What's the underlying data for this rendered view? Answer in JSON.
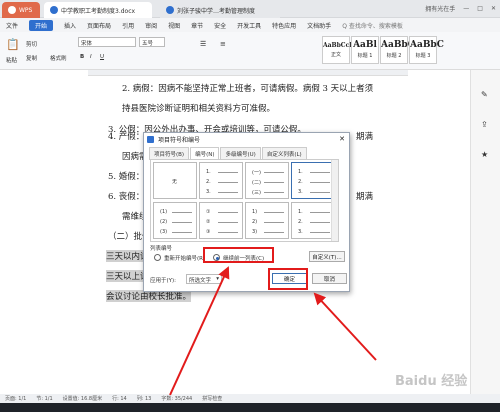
{
  "titlebar": {
    "app": "WPS",
    "doc1": "中学教职工考勤制度3.docx",
    "doc2": "刘张子骏中学…考勤管理制度",
    "user": "拥有光在手"
  },
  "menu": [
    "文件",
    "开始",
    "插入",
    "页面布局",
    "引用",
    "审阅",
    "视图",
    "章节",
    "安全",
    "开发工具",
    "特色应用",
    "文档助手"
  ],
  "menu_tail": "Q 查找命令、搜索模板",
  "ribbon": {
    "paste": "粘贴",
    "cut": "剪切",
    "copy": "复制",
    "format_painter": "格式刷",
    "font": "宋体",
    "size": "五号",
    "styles": [
      {
        "preview": "AaBbCcDd",
        "label": "正文"
      },
      {
        "preview": "AaBl",
        "label": "标题 1"
      },
      {
        "preview": "AaBbC",
        "label": "标题 2"
      },
      {
        "preview": "AaBbC",
        "label": "标题 3"
      }
    ]
  },
  "doc": {
    "p2a": "2. 病假：因病不能坚持正常上班者，可请病假。病假 3 天以上者须",
    "p2b": "持县医院诊断证明和相关资料方可准假。",
    "p3": "3. 公假：因公外出办事、开会或培训等，可请公假。",
    "p4a": "4. 产假：",
    "p4tail": "期满",
    "p4b": "因病需",
    "p5": "5. 婚假：",
    "p6a": "6. 丧假：",
    "p6tail": "期满",
    "p6b": "需维续",
    "p7": "（二）批假",
    "p8": "三天以内请",
    "p9": "三天以上请",
    "p10": "会议讨论由校长批准。"
  },
  "dialog": {
    "title": "项目符号和编号",
    "tabs": [
      "项目符号(B)",
      "编号(N)",
      "多级编号(U)",
      "自定义列表(L)"
    ],
    "none": "无",
    "section": "列表编号",
    "restart": "重新开始编号(R)",
    "continue": "继续前一列表(C)",
    "custom": "自定义(T)...",
    "apply_label": "应用于(Y):",
    "apply_value": "所选文字",
    "ok": "确定",
    "cancel": "取消",
    "cells": [
      [
        "1.",
        "2.",
        "3."
      ],
      [
        "(一)",
        "(二)",
        "(三)"
      ],
      [
        "1.",
        "2.",
        "3."
      ],
      [
        "(1)",
        "(2)",
        "(3)"
      ],
      [
        "①",
        "②",
        "③"
      ],
      [
        "1)",
        "2)",
        "3)"
      ],
      [
        "1.",
        "2.",
        "3."
      ]
    ]
  },
  "status": [
    "页面: 1/1",
    "节: 1/1",
    "设置值: 16.8厘米",
    "行: 14",
    "列: 13",
    "字数: 35/244",
    "拼写检查"
  ],
  "watermark": "Baidu 经验"
}
